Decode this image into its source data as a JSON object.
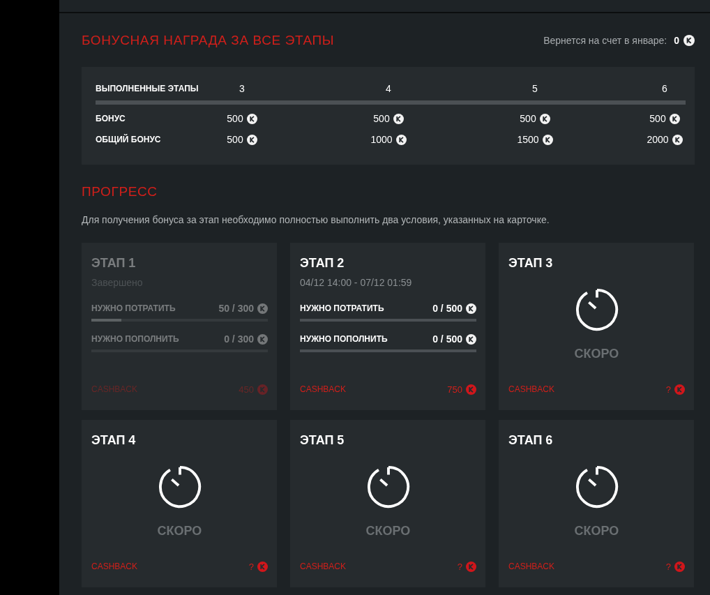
{
  "bonus_section": {
    "title": "БОНУСНАЯ НАГРАДА ЗА ВСЕ ЭТАПЫ",
    "return_note": {
      "label": "Вернется на счет в январе:",
      "amount": "0"
    }
  },
  "bonus_table": {
    "rows": [
      {
        "kind": "count",
        "label": "ВЫПОЛНЕННЫЕ ЭТАПЫ",
        "cells": [
          "3",
          "4",
          "5",
          "6"
        ]
      },
      {
        "kind": "amount",
        "label": "БОНУС",
        "cells": [
          "500",
          "500",
          "500",
          "500"
        ]
      },
      {
        "kind": "amount",
        "label": "ОБЩИЙ БОНУС",
        "cells": [
          "500",
          "1000",
          "1500",
          "2000"
        ]
      }
    ]
  },
  "progress_section": {
    "title": "ПРОГРЕСС",
    "description": "Для получения бонуса за этап необходимо полностью выполнить два условия, указанных на карточке."
  },
  "stages": [
    {
      "kind": "completed",
      "title": "ЭТАП 1",
      "subtitle": "Завершено",
      "conditions": [
        {
          "label": "НУЖНО ПОТРАТИТЬ",
          "value": "50 / 300",
          "level": 0.17
        },
        {
          "label": "НУЖНО ПОПОЛНИТЬ",
          "value": "0 / 300"
        }
      ],
      "cashback": {
        "label": "CASHBACK",
        "value": "450"
      }
    },
    {
      "kind": "active",
      "title": "ЭТАП 2",
      "subtitle": "04/12 14:00 - 07/12 01:59",
      "conditions": [
        {
          "label": "НУЖНО ПОТРАТИТЬ",
          "value": "0 / 500"
        },
        {
          "label": "НУЖНО ПОПОЛНИТЬ",
          "value": "0 / 500"
        }
      ],
      "cashback": {
        "label": "CASHBACK",
        "value": "750"
      }
    },
    {
      "kind": "locked",
      "title": "ЭТАП 3",
      "soon_label": "СКОРО",
      "cashback": {
        "label": "CASHBACK",
        "value": "?"
      }
    },
    {
      "kind": "locked",
      "title": "ЭТАП 4",
      "soon_label": "СКОРО",
      "cashback": {
        "label": "CASHBACK",
        "value": "?"
      }
    },
    {
      "kind": "locked",
      "title": "ЭТАП 5",
      "soon_label": "СКОРО",
      "cashback": {
        "label": "CASHBACK",
        "value": "?"
      }
    },
    {
      "kind": "locked",
      "title": "ЭТАП 6",
      "soon_label": "СКОРО",
      "cashback": {
        "label": "CASHBACK",
        "value": "?"
      }
    }
  ]
}
